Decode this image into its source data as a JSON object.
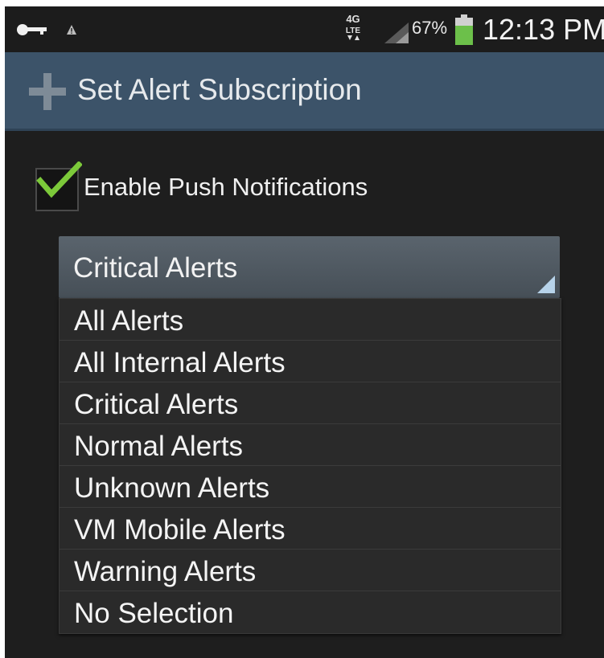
{
  "status_bar": {
    "network_type": "4G LTE",
    "battery_percent": "67%",
    "time": "12:13 PM",
    "icons": [
      "key-icon",
      "warning-icon",
      "lte-icon",
      "signal-icon",
      "battery-icon"
    ],
    "battery_color": "#6cc04a"
  },
  "action_bar": {
    "title": "Set Alert Subscription",
    "icon": "plus-icon",
    "color": "#3c5369"
  },
  "push_notifications": {
    "label": "Enable Push Notifications",
    "checked": true,
    "check_color": "#7cc93a"
  },
  "alert_spinner": {
    "selected": "Critical Alerts",
    "options": [
      "All Alerts",
      "All Internal Alerts",
      "Critical Alerts",
      "Normal Alerts",
      "Unknown Alerts",
      "VM Mobile Alerts",
      "Warning Alerts",
      "No Selection"
    ]
  }
}
